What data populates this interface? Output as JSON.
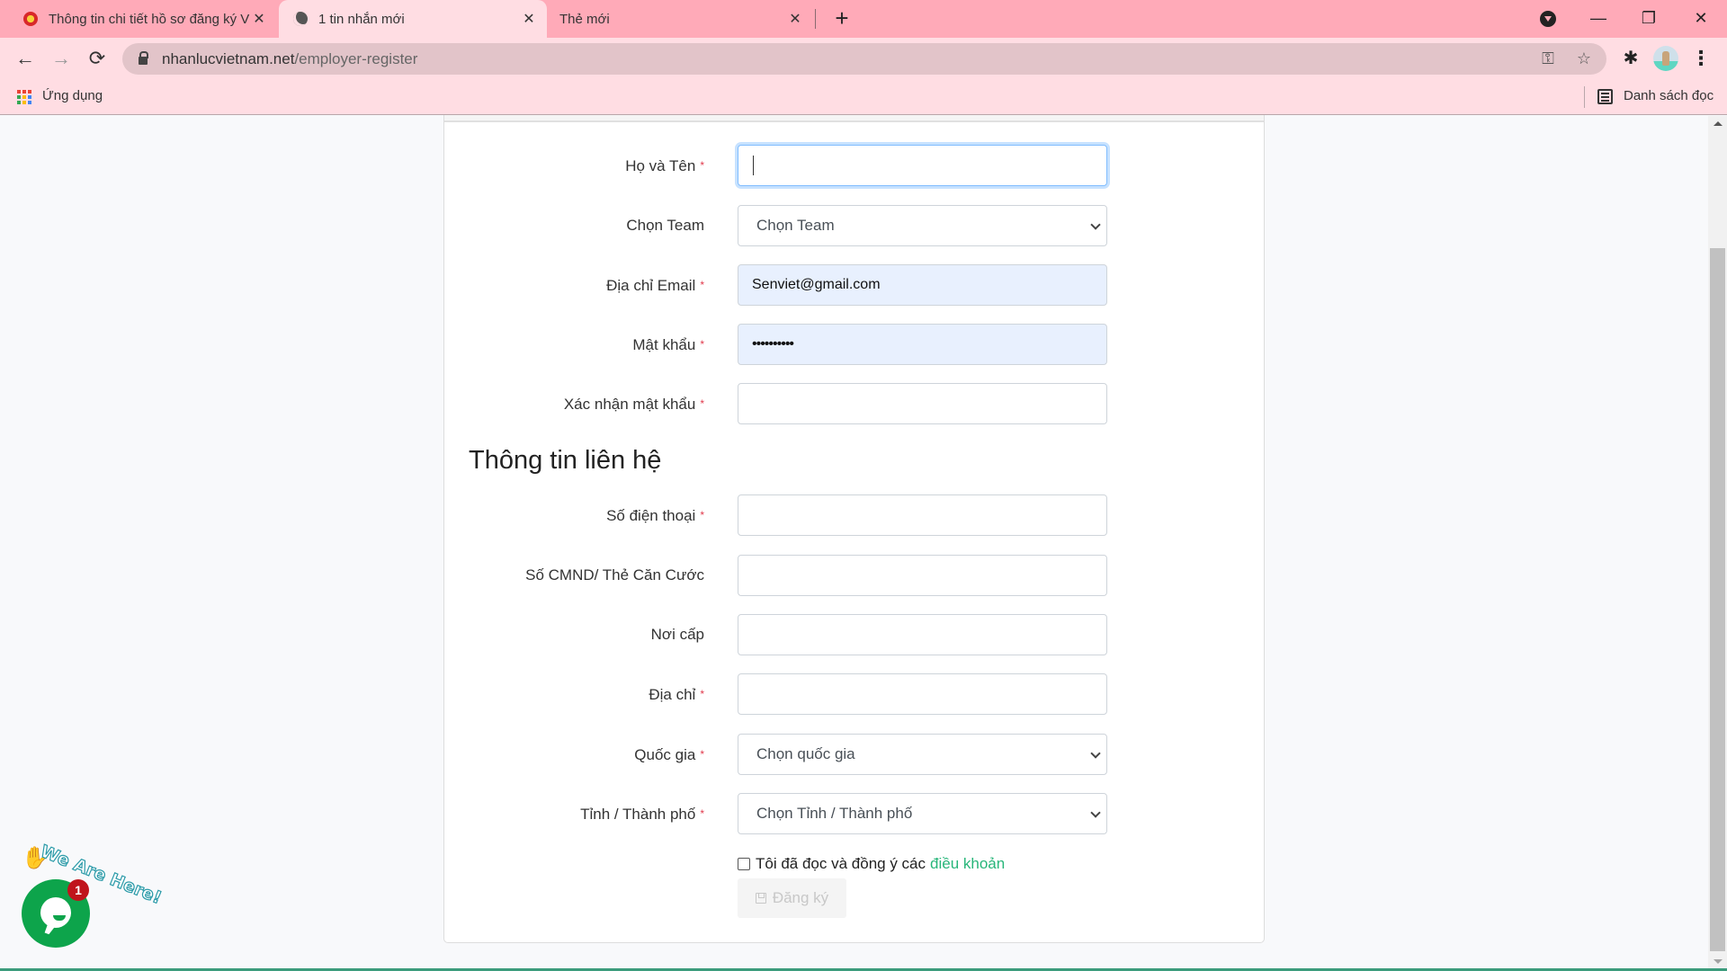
{
  "browser": {
    "tabs": [
      {
        "title": "Thông tin chi tiết hồ sơ đăng ký V",
        "icon": "emblem-favicon",
        "active": false
      },
      {
        "title": "1 tin nhắn mới",
        "icon": "globe-icon",
        "active": true
      },
      {
        "title": "Thẻ mới",
        "icon": "",
        "active": false
      }
    ],
    "close_glyph": "✕",
    "new_tab_glyph": "+",
    "url_domain": "nhanlucvietnam.net",
    "url_path": "/employer-register",
    "bookmarks": {
      "apps_label": "Ứng dụng",
      "reading_list_label": "Danh sách đọc"
    },
    "icons": {
      "back": "←",
      "forward": "→",
      "reload": "⟳",
      "key": "⚿",
      "star": "☆",
      "extensions": "✱",
      "menu": "⋮",
      "minimize": "—",
      "maximize": "❐",
      "close": "✕"
    },
    "colors": {
      "tabbar": "#ffaab8",
      "toolbar": "#ffdde3",
      "omnibox": "#e2c4c9"
    }
  },
  "form": {
    "account_fields": [
      {
        "label": "Họ và Tên",
        "required": true,
        "type": "text",
        "value": "",
        "focused": true
      },
      {
        "label": "Chọn Team",
        "required": false,
        "type": "select",
        "value": "Chọn Team"
      },
      {
        "label": "Địa chỉ Email",
        "required": true,
        "type": "email",
        "value": "Senviet@gmail.com",
        "autofilled": true
      },
      {
        "label": "Mật khẩu",
        "required": true,
        "type": "password",
        "value": "••••••••••",
        "autofilled": true
      },
      {
        "label": "Xác nhận mật khẩu",
        "required": true,
        "type": "password",
        "value": ""
      }
    ],
    "contact_section_title": "Thông tin liên hệ",
    "contact_fields": [
      {
        "label": "Số điện thoại",
        "required": true,
        "type": "text",
        "value": ""
      },
      {
        "label": "Số CMND/ Thẻ Căn Cước",
        "required": false,
        "type": "text",
        "value": ""
      },
      {
        "label": "Nơi cấp",
        "required": false,
        "type": "text",
        "value": ""
      },
      {
        "label": "Địa chỉ",
        "required": true,
        "type": "text",
        "value": ""
      },
      {
        "label": "Quốc gia",
        "required": true,
        "type": "select",
        "value": "Chọn quốc gia"
      },
      {
        "label": "Tỉnh / Thành phố",
        "required": true,
        "type": "select",
        "value": "Chọn Tỉnh / Thành phố"
      }
    ],
    "required_mark": "*",
    "terms_text": "Tôi đã đọc và đồng ý các",
    "terms_link": "điều khoản",
    "terms_checked": false,
    "submit_label": "Đăng ký",
    "submit_disabled": true,
    "colors": {
      "required": "#e0394b",
      "link": "#28b67a",
      "autofill_bg": "#e8f0fe"
    }
  },
  "chat_widget": {
    "tagline": "We Are Here!",
    "badge_count": "1",
    "color": "#0da44b"
  }
}
